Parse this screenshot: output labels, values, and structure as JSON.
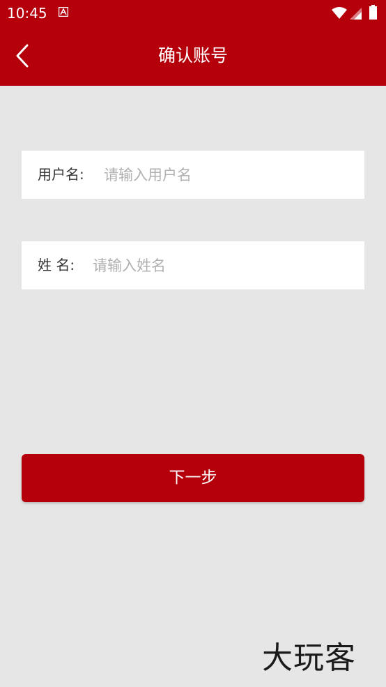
{
  "status_bar": {
    "time": "10:45"
  },
  "header": {
    "title": "确认账号",
    "back_icon": "chevron-left-icon"
  },
  "form": {
    "username": {
      "label": "用户名:",
      "placeholder": "请输入用户名",
      "value": ""
    },
    "name": {
      "label": "姓 名:",
      "placeholder": "请输入姓名",
      "value": ""
    }
  },
  "next_button": {
    "label": "下一步"
  },
  "watermark": {
    "text": "大玩客"
  },
  "colors": {
    "brand": "#b5000c",
    "background": "#e6e6e6",
    "field_background": "#ffffff",
    "placeholder": "#b0b0b0"
  }
}
